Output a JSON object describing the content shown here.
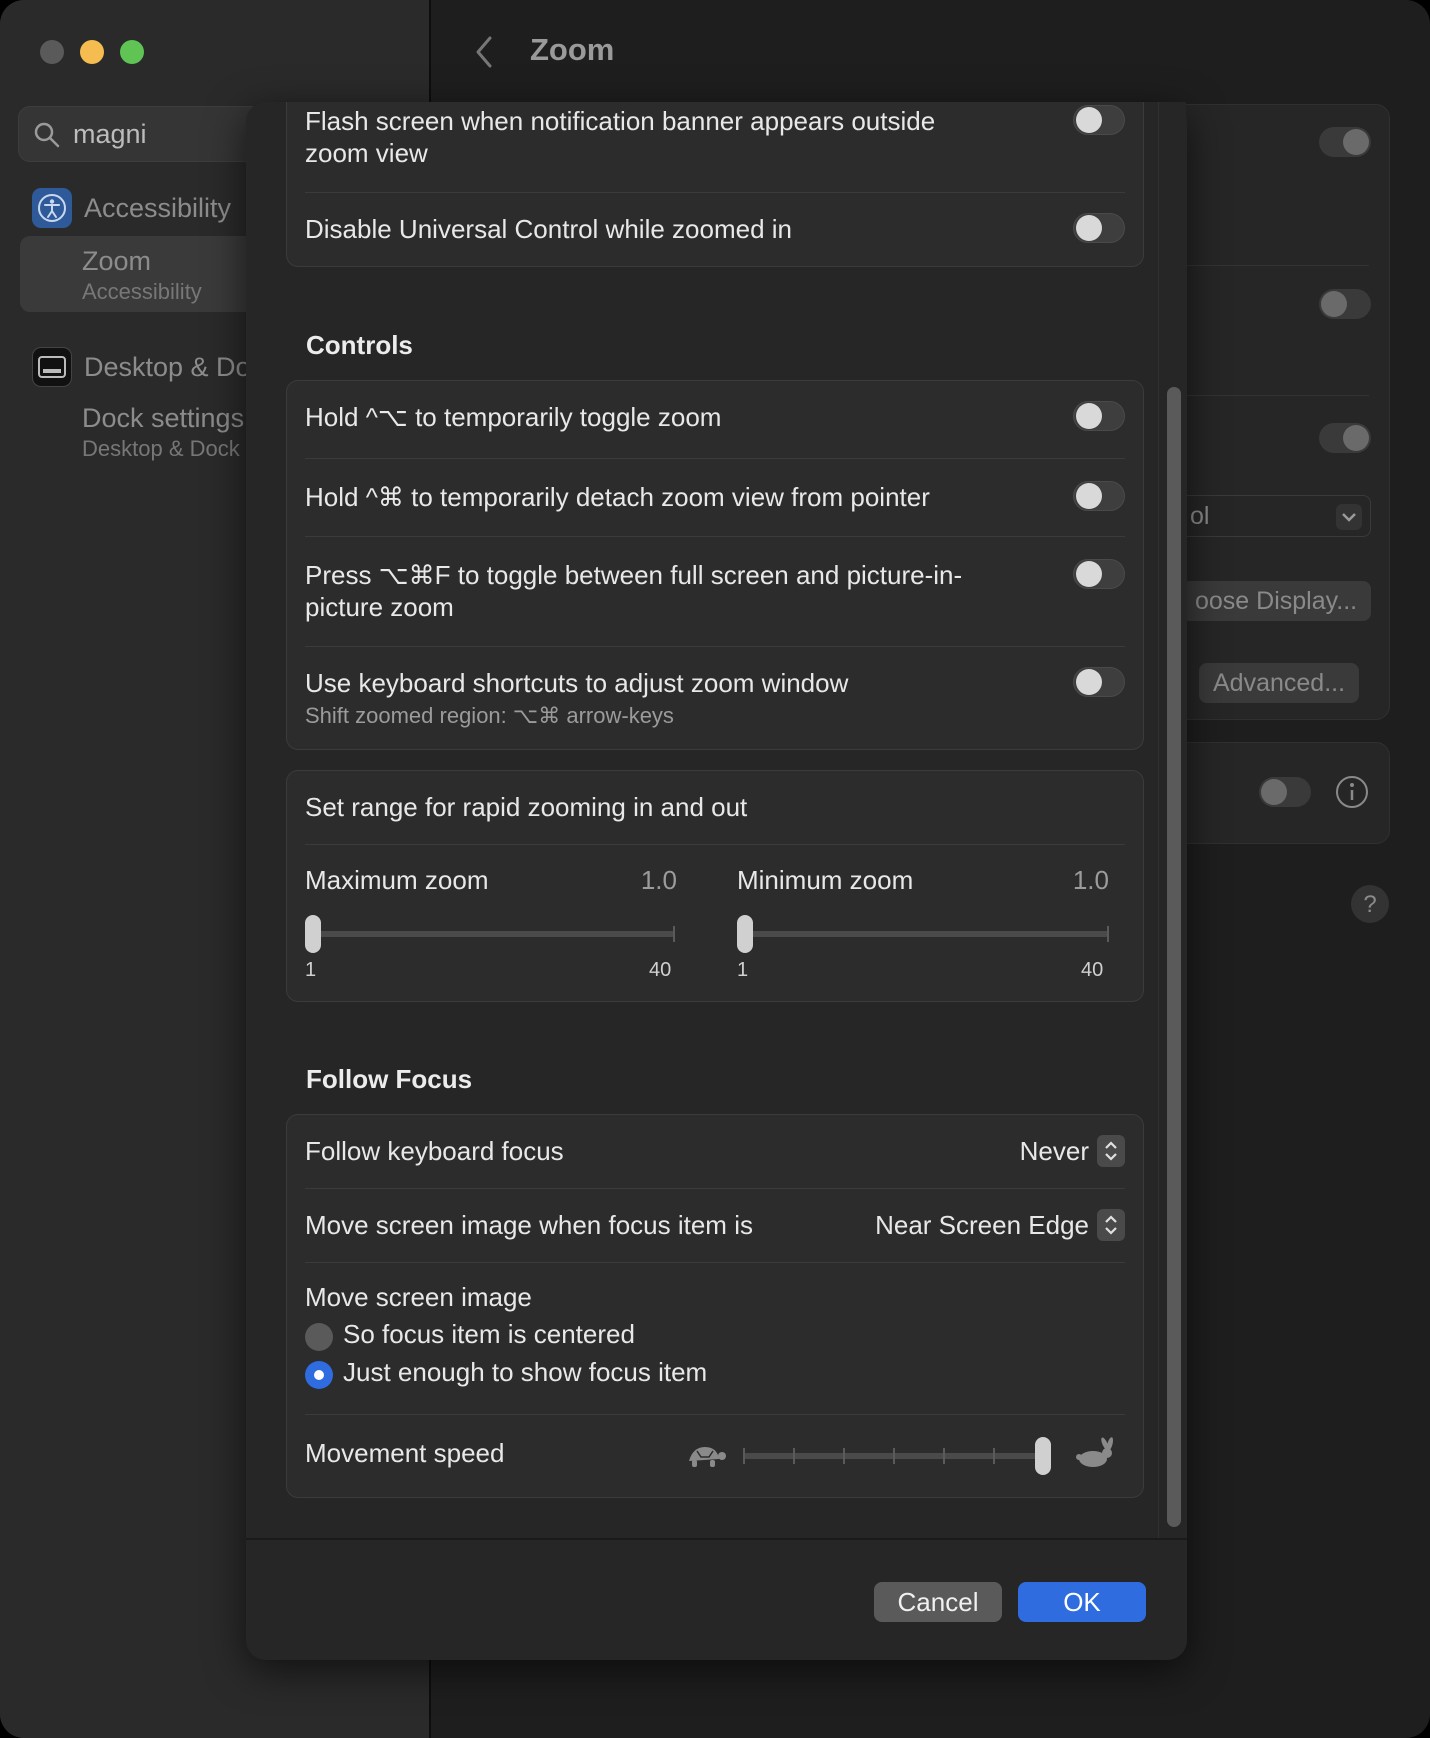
{
  "window": {
    "title": "Zoom"
  },
  "sidebar": {
    "search_value": "magni",
    "sections": [
      {
        "label": "Accessibility",
        "icon": "accessibility-icon"
      },
      {
        "label": "Desktop & Do",
        "icon": "desktop-dock-icon"
      }
    ],
    "results": [
      {
        "title": "Zoom",
        "subtitle": "Accessibility",
        "selected": true
      },
      {
        "title": "Dock settings",
        "subtitle": "Desktop & Dock",
        "selected": false
      }
    ]
  },
  "background": {
    "dropdown_fragment": "ol",
    "choose_display_label": "oose Display...",
    "advanced_label": "Advanced..."
  },
  "sheet": {
    "top_group": [
      {
        "label": "Flash screen when notification banner appears outside zoom view",
        "on": false
      },
      {
        "label": "Disable Universal Control while zoomed in",
        "on": false
      }
    ],
    "controls_heading": "Controls",
    "controls": [
      {
        "label": "Hold ^⌥ to temporarily toggle zoom",
        "on": false
      },
      {
        "label": "Hold ^⌘ to temporarily detach zoom view from pointer",
        "on": false
      },
      {
        "label": "Press ⌥⌘F to toggle between full screen and picture-in-picture zoom",
        "on": false
      },
      {
        "label": "Use keyboard shortcuts to adjust zoom window",
        "sub": "Shift zoomed region: ⌥⌘ arrow-keys",
        "on": false
      }
    ],
    "range": {
      "title": "Set range for rapid zooming in and out",
      "max_label": "Maximum zoom",
      "max_value": "1.0",
      "min_label": "Minimum zoom",
      "min_value": "1.0",
      "range_min": "1",
      "range_max": "40"
    },
    "follow_heading": "Follow Focus",
    "follow": {
      "keyboard_label": "Follow keyboard focus",
      "keyboard_value": "Never",
      "move_when_label": "Move screen image when focus item is",
      "move_when_value": "Near Screen Edge",
      "move_image_label": "Move screen image",
      "radio_options": [
        {
          "label": "So focus item is centered",
          "selected": false
        },
        {
          "label": "Just enough to show focus item",
          "selected": true
        }
      ],
      "speed_label": "Movement speed",
      "speed_fraction": 1.0
    },
    "cancel_label": "Cancel",
    "ok_label": "OK"
  },
  "colors": {
    "accent": "#2e6ce0",
    "close": "#5a5a5a",
    "minimize": "#f5bd4f",
    "maximize": "#5fc454"
  }
}
